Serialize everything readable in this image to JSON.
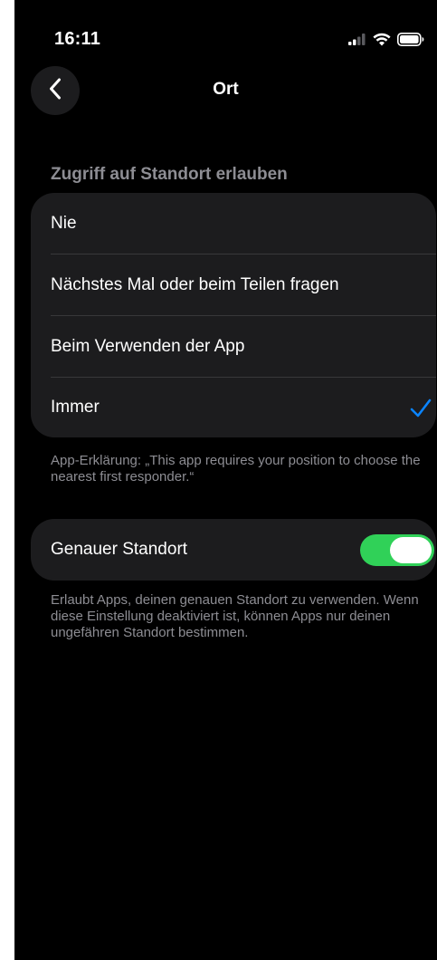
{
  "status_bar": {
    "time": "16:11",
    "icons": [
      "cellular-signal-icon",
      "wifi-icon",
      "battery-icon"
    ]
  },
  "nav": {
    "back_icon": "chevron-left-icon",
    "title": "Ort"
  },
  "location_access": {
    "header": "Zugriff auf Standort erlauben",
    "options": [
      {
        "label": "Nie",
        "selected": false
      },
      {
        "label": "Nächstes Mal oder beim Teilen fragen",
        "selected": false
      },
      {
        "label": "Beim Verwenden der App",
        "selected": false
      },
      {
        "label": "Immer",
        "selected": true
      }
    ],
    "explanation": "App-Erklärung: „This app requires your position to choose the nearest first responder.“"
  },
  "precise_location": {
    "label": "Genauer Standort",
    "enabled": true,
    "description": "Erlaubt Apps, deinen genauen Standort zu verwenden. Wenn diese Einstellung deaktiviert ist, können Apps nur deinen ungefähren Standort bestimmen."
  },
  "colors": {
    "background": "#000000",
    "card": "#1c1c1e",
    "accent": "#0a84ff",
    "toggle_on": "#30d158",
    "secondary_text": "#8d8d93"
  }
}
